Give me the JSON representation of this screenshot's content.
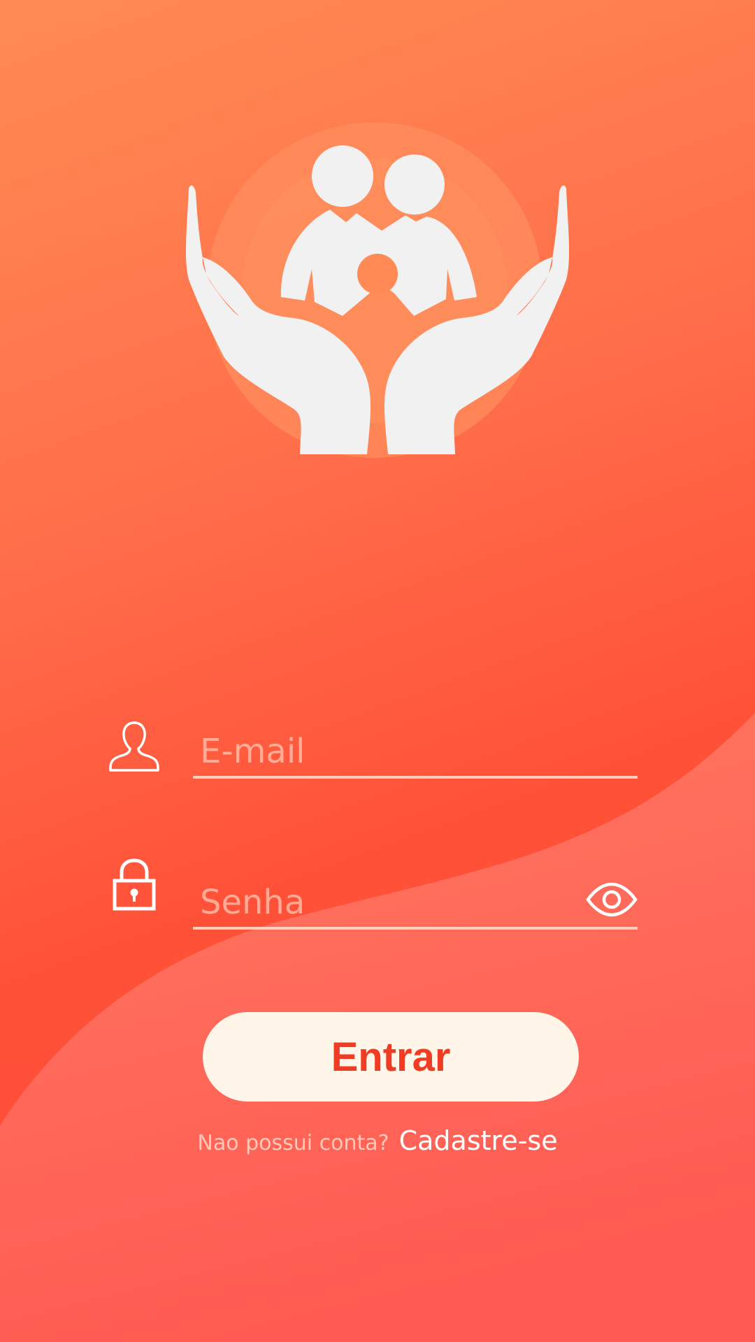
{
  "login": {
    "email_placeholder": "E-mail",
    "password_placeholder": "Senha",
    "submit_label": "Entrar",
    "signup_prompt": "Nao possui conta?",
    "signup_link": "Cadastre-se"
  },
  "icons": {
    "logo": "family-care-hands-logo",
    "email": "user-icon",
    "password": "lock-icon",
    "toggle_password": "eye-icon"
  },
  "colors": {
    "background_top": "#ff8b54",
    "background_bottom": "#ff4a36",
    "button_background": "#fff5e8",
    "button_text": "#f03c22"
  }
}
